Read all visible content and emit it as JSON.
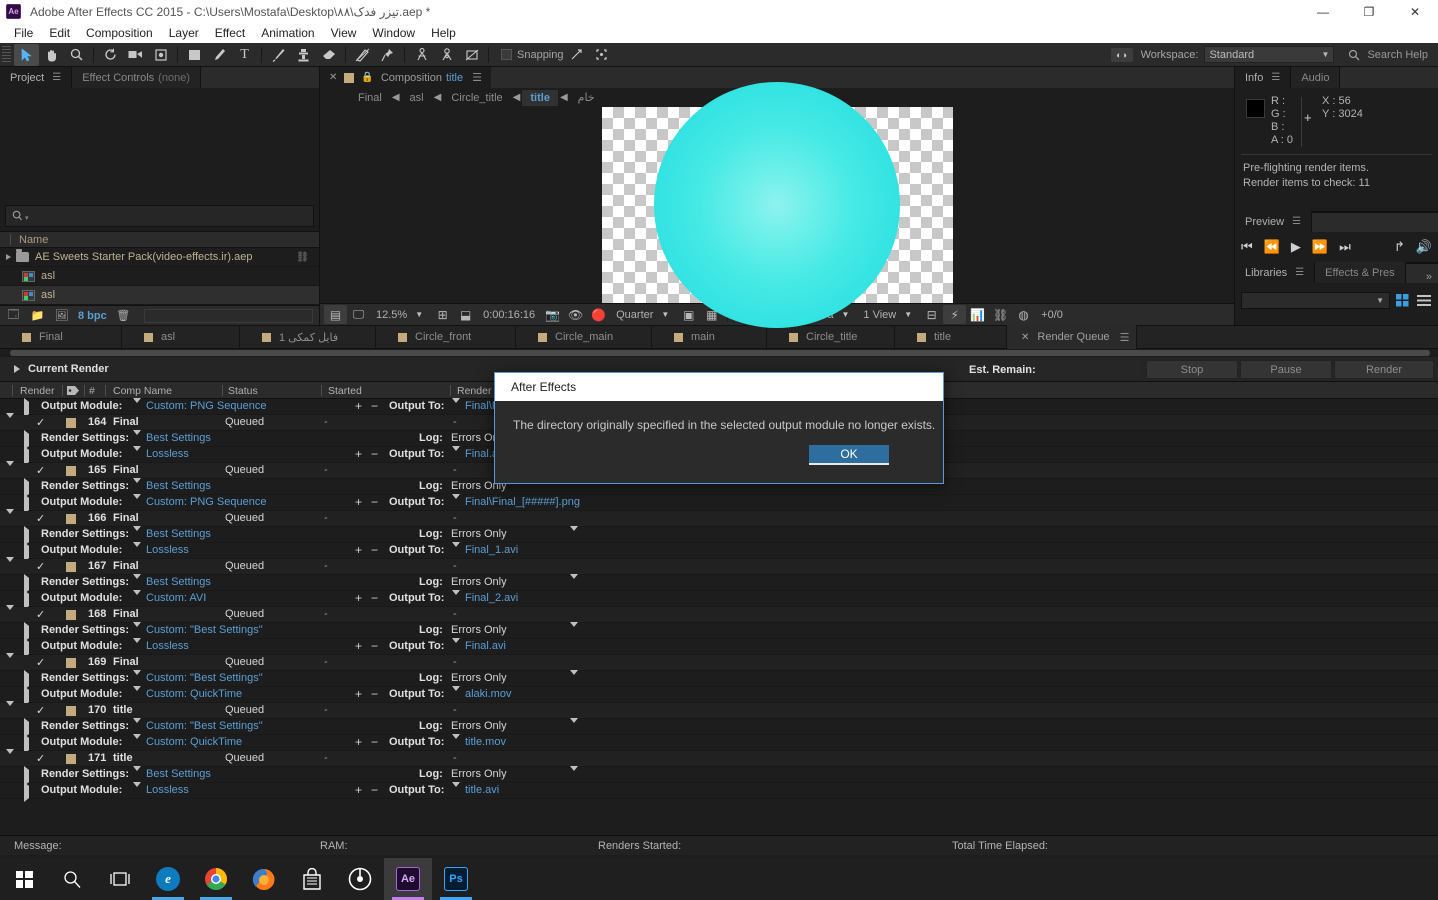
{
  "window": {
    "title": "Adobe After Effects CC 2015 - C:\\Users\\Mostafa\\Desktop\\۸۸\\تیزر فدک.aep *",
    "logo": "Ae",
    "minimize": "—",
    "maximize": "❐",
    "close": "✕"
  },
  "menu": [
    "File",
    "Edit",
    "Composition",
    "Layer",
    "Effect",
    "Animation",
    "View",
    "Window",
    "Help"
  ],
  "toolbar": {
    "snapping_label": "Snapping",
    "workspace_label": "Workspace:",
    "workspace_value": "Standard",
    "search_help": "Search Help",
    "tools": [
      {
        "name": "selection-tool",
        "glyph": "➤"
      },
      {
        "name": "hand-tool",
        "glyph": "✋"
      },
      {
        "name": "zoom-tool",
        "glyph": "⌕"
      },
      {
        "name": "rotation-tool",
        "glyph": "⟳"
      },
      {
        "name": "camera-tool",
        "glyph": "▣"
      },
      {
        "name": "pan-behind-tool",
        "glyph": "✥"
      },
      {
        "name": "shape-tool",
        "glyph": "▢"
      },
      {
        "name": "pen-tool",
        "glyph": "✒"
      },
      {
        "name": "type-tool",
        "glyph": "T"
      },
      {
        "name": "brush-tool",
        "glyph": "🖌"
      },
      {
        "name": "clone-stamp-tool",
        "glyph": "⚱"
      },
      {
        "name": "eraser-tool",
        "glyph": "◧"
      },
      {
        "name": "roto-brush-tool",
        "glyph": "𝄃"
      },
      {
        "name": "puppet-pin-tool",
        "glyph": "📌"
      },
      {
        "name": "puppet-overlap-tool",
        "glyph": "⌇"
      },
      {
        "name": "puppet-starch-tool",
        "glyph": "⌁"
      },
      {
        "name": "puppet-mesh-tool",
        "glyph": "⊠"
      }
    ]
  },
  "project_panel": {
    "tabs": [
      {
        "label": "Project",
        "active": true,
        "suffix": ""
      },
      {
        "label": "Effect Controls",
        "active": false,
        "suffix": "(none)"
      }
    ],
    "search_placeholder": "",
    "column_header": "Name",
    "items": [
      {
        "name": "AE Sweets Starter Pack(video-effects.ir).aep",
        "type": "folder",
        "expandable": true
      },
      {
        "name": "asl",
        "type": "composition",
        "selected": false
      },
      {
        "name": "asl",
        "type": "composition",
        "selected": true
      }
    ],
    "footer": {
      "bpc": "8 bpc"
    }
  },
  "composition_panel": {
    "tab": {
      "close": "✕",
      "title": "Composition",
      "comp_name": "title"
    },
    "breadcrumbs": [
      {
        "label": "Final",
        "current": false
      },
      {
        "label": "asl",
        "current": false
      },
      {
        "label": "Circle_title",
        "current": false
      },
      {
        "label": "title",
        "current": true
      },
      {
        "label": "خام",
        "current": false
      }
    ],
    "bottom_bar": {
      "zoom": "12.5%",
      "time": "0:00:16:16",
      "resolution": "Quarter",
      "view_camera": "Active Camera",
      "views": "1 View",
      "frame_offset": "+0/0"
    },
    "canvas": {
      "shape_color": "#3ce6e2"
    }
  },
  "info_panel": {
    "tabs": [
      {
        "label": "Info",
        "active": true
      },
      {
        "label": "Audio",
        "active": false
      }
    ],
    "color": {
      "R": "R :",
      "G": "G :",
      "B": "B :",
      "A": "A : 0"
    },
    "position": {
      "X": "X : 56",
      "Y": "Y : 3024"
    },
    "messages": [
      "Pre-flighting render items.",
      "Render items to check: 11"
    ]
  },
  "preview_panel": {
    "title": "Preview",
    "controls": [
      "⏮",
      "⏪",
      "▶",
      "⏩",
      "⏭",
      "↱",
      "🔊"
    ]
  },
  "libraries_panel": {
    "tabs": [
      {
        "label": "Libraries",
        "active": true
      },
      {
        "label": "Effects & Pres",
        "active": false
      }
    ],
    "overflow": "»"
  },
  "comp_strip_tabs": [
    {
      "label": "Final",
      "type": "comp"
    },
    {
      "label": "asl",
      "type": "comp"
    },
    {
      "label": "فایل کمکی 1",
      "type": "comp"
    },
    {
      "label": "Circle_front",
      "type": "comp"
    },
    {
      "label": "Circle_main",
      "type": "comp"
    },
    {
      "label": "main",
      "type": "comp"
    },
    {
      "label": "Circle_title",
      "type": "comp"
    },
    {
      "label": "title",
      "type": "comp"
    },
    {
      "label": "Render Queue",
      "type": "render-queue",
      "active": true
    }
  ],
  "render_queue": {
    "current_render_label": "Current Render",
    "est_remain_label": "Est. Remain:",
    "buttons": [
      {
        "label": "Stop",
        "name": "stop-button"
      },
      {
        "label": "Pause",
        "name": "pause-button"
      },
      {
        "label": "Render",
        "name": "render-button"
      }
    ],
    "columns": [
      "Render",
      "#",
      "Comp Name",
      "Status",
      "Started",
      "Render T"
    ],
    "labels": {
      "render_settings": "Render Settings:",
      "output_module": "Output Module:",
      "output_to": "Output To:",
      "log": "Log:",
      "status_queued": "Queued",
      "dash": "-"
    },
    "rows": [
      {
        "kind": "output_module",
        "module": "Custom: PNG Sequence",
        "output_to": "Final\\F"
      },
      {
        "kind": "item",
        "num": "164",
        "comp": "Final",
        "status": "Queued"
      },
      {
        "kind": "render_settings",
        "settings": "Best Settings",
        "log": "Errors Only"
      },
      {
        "kind": "output_module",
        "module": "Lossless",
        "output_to": "Final.avi"
      },
      {
        "kind": "item",
        "num": "165",
        "comp": "Final",
        "status": "Queued"
      },
      {
        "kind": "render_settings",
        "settings": "Best Settings",
        "log": "Errors Only"
      },
      {
        "kind": "output_module",
        "module": "Custom: PNG Sequence",
        "output_to": "Final\\Final_[#####].png"
      },
      {
        "kind": "item",
        "num": "166",
        "comp": "Final",
        "status": "Queued"
      },
      {
        "kind": "render_settings",
        "settings": "Best Settings",
        "log": "Errors Only"
      },
      {
        "kind": "output_module",
        "module": "Lossless",
        "output_to": "Final_1.avi"
      },
      {
        "kind": "item",
        "num": "167",
        "comp": "Final",
        "status": "Queued"
      },
      {
        "kind": "render_settings",
        "settings": "Best Settings",
        "log": "Errors Only"
      },
      {
        "kind": "output_module",
        "module": "Custom: AVI",
        "output_to": "Final_2.avi"
      },
      {
        "kind": "item",
        "num": "168",
        "comp": "Final",
        "status": "Queued"
      },
      {
        "kind": "render_settings",
        "settings": "Custom: \"Best Settings\"",
        "log": "Errors Only"
      },
      {
        "kind": "output_module",
        "module": "Lossless",
        "output_to": "Final.avi"
      },
      {
        "kind": "item",
        "num": "169",
        "comp": "Final",
        "status": "Queued"
      },
      {
        "kind": "render_settings",
        "settings": "Custom: \"Best Settings\"",
        "log": "Errors Only"
      },
      {
        "kind": "output_module",
        "module": "Custom: QuickTime",
        "output_to": "alaki.mov"
      },
      {
        "kind": "item",
        "num": "170",
        "comp": "title",
        "status": "Queued"
      },
      {
        "kind": "render_settings",
        "settings": "Custom: \"Best Settings\"",
        "log": "Errors Only"
      },
      {
        "kind": "output_module",
        "module": "Custom: QuickTime",
        "output_to": "title.mov"
      },
      {
        "kind": "item",
        "num": "171",
        "comp": "title",
        "status": "Queued"
      },
      {
        "kind": "render_settings",
        "settings": "Best Settings",
        "log": "Errors Only"
      },
      {
        "kind": "output_module",
        "module": "Lossless",
        "output_to": "title.avi"
      }
    ]
  },
  "status_bar": {
    "message": "Message:",
    "ram": "RAM:",
    "renders_started": "Renders Started:",
    "total_time": "Total Time Elapsed:"
  },
  "dialog": {
    "title": "After Effects",
    "message": "The directory originally specified in the selected output module no longer exists.",
    "ok": "OK"
  },
  "taskbar": {
    "items": [
      {
        "name": "start-button",
        "glyph": "",
        "kind": "windows"
      },
      {
        "name": "search-icon",
        "glyph": "⌕",
        "kind": "glyph",
        "color": "#ffffff"
      },
      {
        "name": "task-view-icon",
        "glyph": "❑",
        "kind": "glyph",
        "color": "#ffffff"
      },
      {
        "name": "edge-icon",
        "glyph": "e",
        "kind": "circle",
        "color": "#0d7cc0"
      },
      {
        "name": "chrome-icon",
        "glyph": "◉",
        "kind": "circle",
        "color": "#4285f4",
        "accent": "#34a853"
      },
      {
        "name": "firefox-icon",
        "glyph": "◍",
        "kind": "circle",
        "color": "#e66000"
      },
      {
        "name": "store-icon",
        "glyph": "🛍",
        "kind": "glyph",
        "color": "#ffffff"
      },
      {
        "name": "media-player-icon",
        "glyph": "◎",
        "kind": "circle",
        "color": "#ffffff"
      },
      {
        "name": "after-effects-icon",
        "glyph": "Ae",
        "kind": "square",
        "color": "#9b5cd6",
        "active": true
      },
      {
        "name": "photoshop-icon",
        "glyph": "Ps",
        "kind": "square",
        "color": "#31a8ff"
      }
    ]
  }
}
